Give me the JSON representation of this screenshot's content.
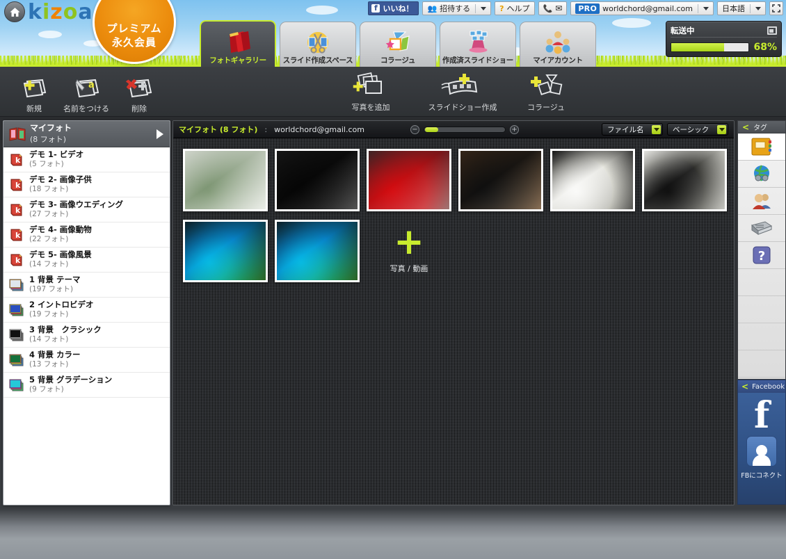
{
  "header": {
    "home_icon": "home-icon",
    "logo_text": "kizoa",
    "premium_line1": "プレミアム",
    "premium_line2": "永久会員",
    "utility": {
      "fb_like": "いいね！",
      "invite": "招待する",
      "help": "ヘルプ",
      "phone_icon": "phone-icon",
      "mail_icon": "mail-icon",
      "pro_badge": "PRO",
      "account_email": "worldchord@gmail.com",
      "language": "日本語",
      "fullscreen_icon": "fullscreen-icon"
    }
  },
  "tabs": [
    {
      "label": "フォトギャラリー",
      "icon": "photo-books-icon",
      "active": true
    },
    {
      "label": "スライド作成スペース",
      "icon": "scissors-icon",
      "active": false
    },
    {
      "label": "コラージュ",
      "icon": "collage-shapes-icon",
      "active": false
    },
    {
      "label": "作成済スライドショー",
      "icon": "magic-hat-icon",
      "active": false
    },
    {
      "label": "マイアカウント",
      "icon": "people-group-icon",
      "active": false
    }
  ],
  "transfer": {
    "label": "転送中",
    "window_icon": "window-restore-icon",
    "percent_text": "68%",
    "percent_value": 68
  },
  "toolbar": {
    "left_tools": [
      {
        "label": "新規",
        "icon": "new-album-icon"
      },
      {
        "label": "名前をつける",
        "icon": "rename-album-icon"
      },
      {
        "label": "削除",
        "icon": "delete-album-icon"
      }
    ],
    "center_tools": [
      {
        "label": "写真を追加",
        "icon": "add-photo-icon"
      },
      {
        "label": "スライドショー作成",
        "icon": "create-slideshow-icon"
      },
      {
        "label": "コラージュ",
        "icon": "create-collage-icon"
      }
    ]
  },
  "albums": {
    "selected": {
      "name": "マイフォト",
      "count": "(8 フォト)",
      "icon": "open-book-icon",
      "arrow_icon": "chevron-right-icon"
    },
    "items": [
      {
        "name": "デモ 1- ビデオ",
        "count": "(5 フォト)",
        "icon": "kizoa-book-icon"
      },
      {
        "name": "デモ 2- 画像子供",
        "count": "(18 フォト)",
        "icon": "kizoa-book-icon"
      },
      {
        "name": "デモ 3- 画像ウエディング",
        "count": "(27 フォト)",
        "icon": "kizoa-book-icon"
      },
      {
        "name": "デモ 4- 画像動物",
        "count": "(22 フォト)",
        "icon": "kizoa-book-icon"
      },
      {
        "name": "デモ 5- 画像風景",
        "count": "(14 フォト)",
        "icon": "kizoa-book-icon"
      },
      {
        "name": "1 背景 テーマ",
        "count": "(197 フォト)",
        "icon": "stack-theme-icon"
      },
      {
        "name": "2 イントロビデオ",
        "count": "(19 フォト)",
        "icon": "stack-video-icon"
      },
      {
        "name": "3 背景　クラシック",
        "count": "(14 フォト)",
        "icon": "stack-classic-icon"
      },
      {
        "name": "4 背景 カラー",
        "count": "(13 フォト)",
        "icon": "stack-color-icon"
      },
      {
        "name": "5 背景 グラデーション",
        "count": "(9 フォト)",
        "icon": "stack-gradient-icon"
      }
    ]
  },
  "content": {
    "title": "マイフォト (8 フォト)",
    "separator": ":",
    "email": "worldchord@gmail.com",
    "zoom_out_icon": "zoom-out-icon",
    "zoom_in_icon": "zoom-in-icon",
    "zoom_value": 12,
    "sort_dropdown": {
      "value": "ファイル名",
      "icon": "chevron-down-icon"
    },
    "view_dropdown": {
      "value": "ベーシック",
      "icon": "chevron-down-icon"
    },
    "photos": [
      {
        "alt": "street-storefront",
        "c1": "#b9bcb6",
        "c2": "#7d8a78",
        "c3": "#dfe2dc"
      },
      {
        "alt": "office-chair-black",
        "c1": "#3a3a3a",
        "c2": "#1a1a1a",
        "c3": "#cfcfcf"
      },
      {
        "alt": "mesh-chairs-red-sofa",
        "c1": "#4a4a4a",
        "c2": "#b4262c",
        "c3": "#dcdcd6"
      },
      {
        "alt": "showroom-chair-wood",
        "c1": "#5a4a3a",
        "c2": "#2b2b2b",
        "c3": "#d4cdc2"
      },
      {
        "alt": "brochure-on-table",
        "c1": "#1e1e1e",
        "c2": "#e8e8e4",
        "c3": "#b5b5b0"
      },
      {
        "alt": "office-desk-chair",
        "c1": "#d8d8d4",
        "c2": "#2a2a2a",
        "c3": "#8e8e8a"
      },
      {
        "alt": "showroom-wide-1",
        "c1": "#2b2f33",
        "c2": "#1b9fc7",
        "c3": "#8cc63f"
      },
      {
        "alt": "showroom-wide-2",
        "c1": "#2b2f33",
        "c2": "#1b9fc7",
        "c3": "#8cc63f"
      }
    ],
    "add_tile": {
      "label": "写真 / 動画",
      "icon": "plus-icon"
    }
  },
  "rail": {
    "tag_header": {
      "label": "タグ",
      "collapse_icon": "chevron-left-icon"
    },
    "items": [
      {
        "icon": "address-book-icon",
        "selected": true
      },
      {
        "icon": "globe-goggles-icon",
        "selected": false
      },
      {
        "icon": "people-icon",
        "selected": false
      },
      {
        "icon": "newspaper-icon",
        "selected": false
      },
      {
        "icon": "help-question-icon",
        "selected": false
      }
    ],
    "facebook": {
      "header": "Facebook",
      "collapse_icon": "chevron-left-icon",
      "logo": "f",
      "connect_label": "FBにコネクト",
      "connect_icon": "person-icon"
    }
  },
  "colors": {
    "accent_green": "#c8ec2e",
    "premium_orange": "#ec8c0d",
    "facebook_blue": "#3b5998",
    "pro_blue": "#1e6fc4",
    "dark_panel": "#2b2d30"
  }
}
